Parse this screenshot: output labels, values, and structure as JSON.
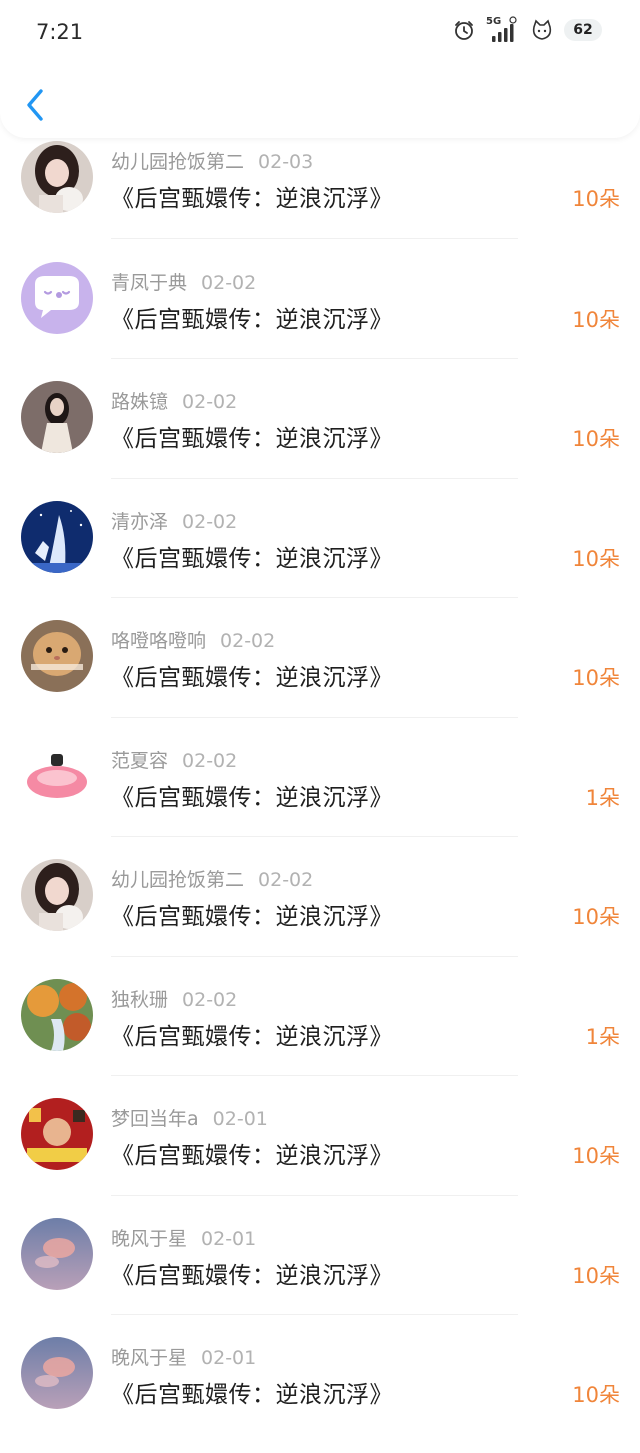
{
  "status_bar": {
    "time": "7:21",
    "network_label": "5G",
    "battery_level": "62",
    "icons": [
      "alarm-clock-icon",
      "signal-icon",
      "notification-pet-icon",
      "battery-icon"
    ]
  },
  "header": {
    "back_icon": "chevron-left-icon",
    "accent_color": "#2196f3"
  },
  "colors": {
    "amount": "#f0853a",
    "name": "#9a9a9a",
    "title": "#1f1f1f"
  },
  "records": [
    {
      "name": "幼儿园抢饭第二",
      "date": "02-03",
      "book": "《后宫甄嬛传：逆浪沉浮》",
      "amount": "10朵"
    },
    {
      "name": "青凤于典",
      "date": "02-02",
      "book": "《后宫甄嬛传：逆浪沉浮》",
      "amount": "10朵"
    },
    {
      "name": "路姝镱",
      "date": "02-02",
      "book": "《后宫甄嬛传：逆浪沉浮》",
      "amount": "10朵"
    },
    {
      "name": "清亦泽",
      "date": "02-02",
      "book": "《后宫甄嬛传：逆浪沉浮》",
      "amount": "10朵"
    },
    {
      "name": "咯噔咯噔响",
      "date": "02-02",
      "book": "《后宫甄嬛传：逆浪沉浮》",
      "amount": "10朵"
    },
    {
      "name": "范夏容",
      "date": "02-02",
      "book": "《后宫甄嬛传：逆浪沉浮》",
      "amount": "1朵"
    },
    {
      "name": "幼儿园抢饭第二",
      "date": "02-02",
      "book": "《后宫甄嬛传：逆浪沉浮》",
      "amount": "10朵"
    },
    {
      "name": "独秋珊",
      "date": "02-02",
      "book": "《后宫甄嬛传：逆浪沉浮》",
      "amount": "1朵"
    },
    {
      "name": "梦回当年a",
      "date": "02-01",
      "book": "《后宫甄嬛传：逆浪沉浮》",
      "amount": "10朵"
    },
    {
      "name": "晚风于星",
      "date": "02-01",
      "book": "《后宫甄嬛传：逆浪沉浮》",
      "amount": "10朵"
    },
    {
      "name": "晚风于星",
      "date": "02-01",
      "book": "《后宫甄嬛传：逆浪沉浮》",
      "amount": "10朵"
    }
  ]
}
